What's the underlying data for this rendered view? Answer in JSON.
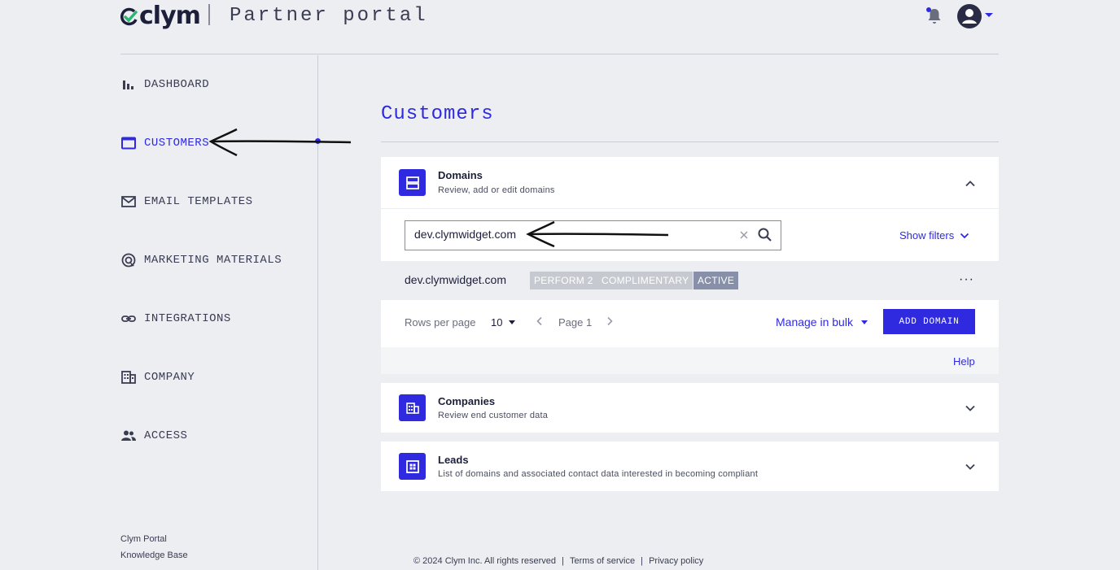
{
  "header": {
    "logo_text": "clym",
    "portal_title": "Partner portal",
    "icons": [
      "bell-icon",
      "user-avatar-icon",
      "caret-down-icon"
    ]
  },
  "sidebar": {
    "items": [
      {
        "label": "DASHBOARD",
        "icon": "bar-chart-icon"
      },
      {
        "label": "CUSTOMERS",
        "icon": "window-icon",
        "active": true
      },
      {
        "label": "EMAIL TEMPLATES",
        "icon": "mail-icon"
      },
      {
        "label": "MARKETING MATERIALS",
        "icon": "target-icon"
      },
      {
        "label": "INTEGRATIONS",
        "icon": "link-icon"
      },
      {
        "label": "COMPANY",
        "icon": "building-icon"
      },
      {
        "label": "ACCESS",
        "icon": "people-icon"
      }
    ],
    "bottom_links": [
      "Clym Portal",
      "Knowledge Base"
    ]
  },
  "main": {
    "title": "Customers",
    "domains": {
      "title": "Domains",
      "subtitle": "Review, add or edit domains",
      "search_value": "dev.clymwidget.com",
      "show_filters": "Show filters",
      "rows": [
        {
          "domain": "dev.clymwidget.com",
          "badges": [
            "PERFORM 2",
            "COMPLIMENTARY",
            "ACTIVE"
          ],
          "more": "···"
        }
      ],
      "rows_per_page_label": "Rows per page",
      "rows_per_page_value": "10",
      "page_label": "Page 1",
      "manage_bulk": "Manage in bulk",
      "add_domain": "ADD DOMAIN",
      "help": "Help"
    },
    "companies": {
      "title": "Companies",
      "subtitle": "Review end customer data"
    },
    "leads": {
      "title": "Leads",
      "subtitle": "List of domains and associated contact data interested in becoming compliant"
    }
  },
  "footer": {
    "copyright": "© 2024 Clym Inc. All rights reserved",
    "sep": "|",
    "terms": "Terms of service",
    "privacy": "Privacy policy"
  },
  "colors": {
    "accent": "#2f2ae0",
    "background": "#eceef2",
    "text": "#1d1f3a",
    "badge_grey": "#c7c9d0",
    "badge_active": "#8790a8"
  }
}
